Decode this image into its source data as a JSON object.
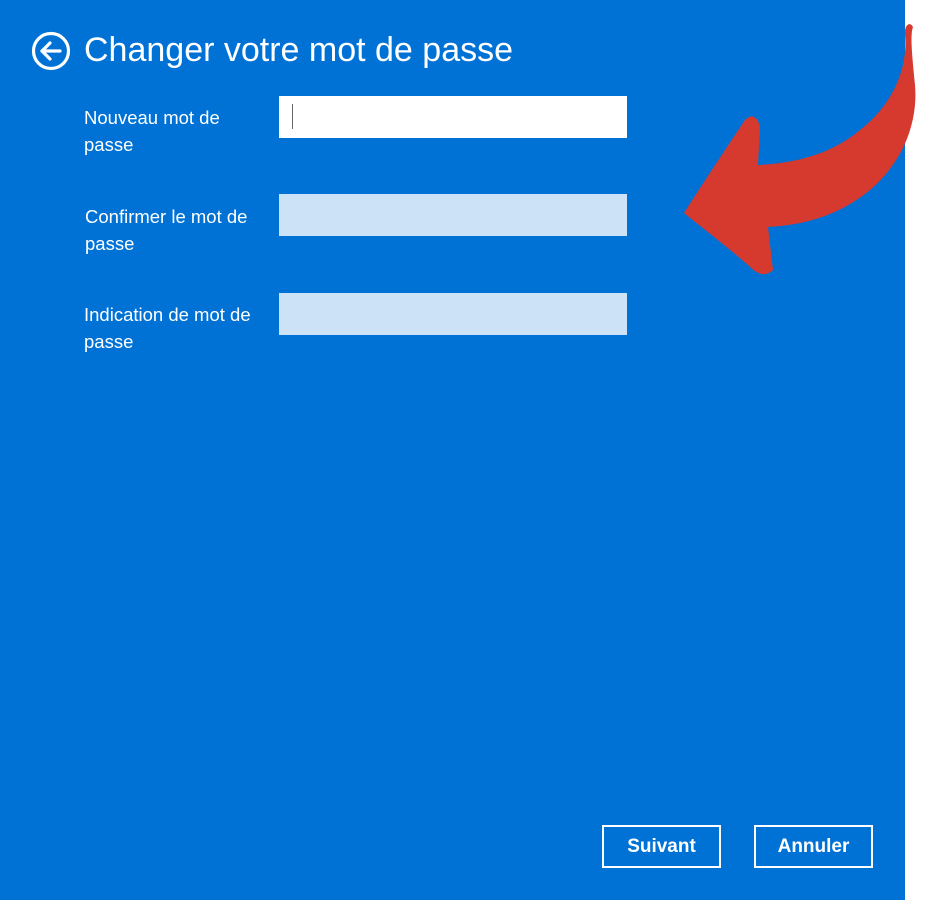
{
  "header": {
    "title": "Changer votre mot de passe",
    "back_icon": "back-arrow-circle-icon"
  },
  "form": {
    "fields": [
      {
        "label": "Nouveau mot de passe",
        "value": "",
        "state": "focused"
      },
      {
        "label": "Confirmer le mot de passe",
        "value": "",
        "state": "default"
      },
      {
        "label": "Indication de mot de passe",
        "value": "",
        "state": "default"
      }
    ]
  },
  "footer": {
    "next_label": "Suivant",
    "cancel_label": "Annuler"
  },
  "annotation": {
    "icon": "red-curved-arrow-icon",
    "color": "#d63a2f"
  },
  "colors": {
    "panel_bg": "#0072d6",
    "input_active": "#ffffff",
    "input_inactive": "#cce2f6",
    "text": "#ffffff"
  }
}
